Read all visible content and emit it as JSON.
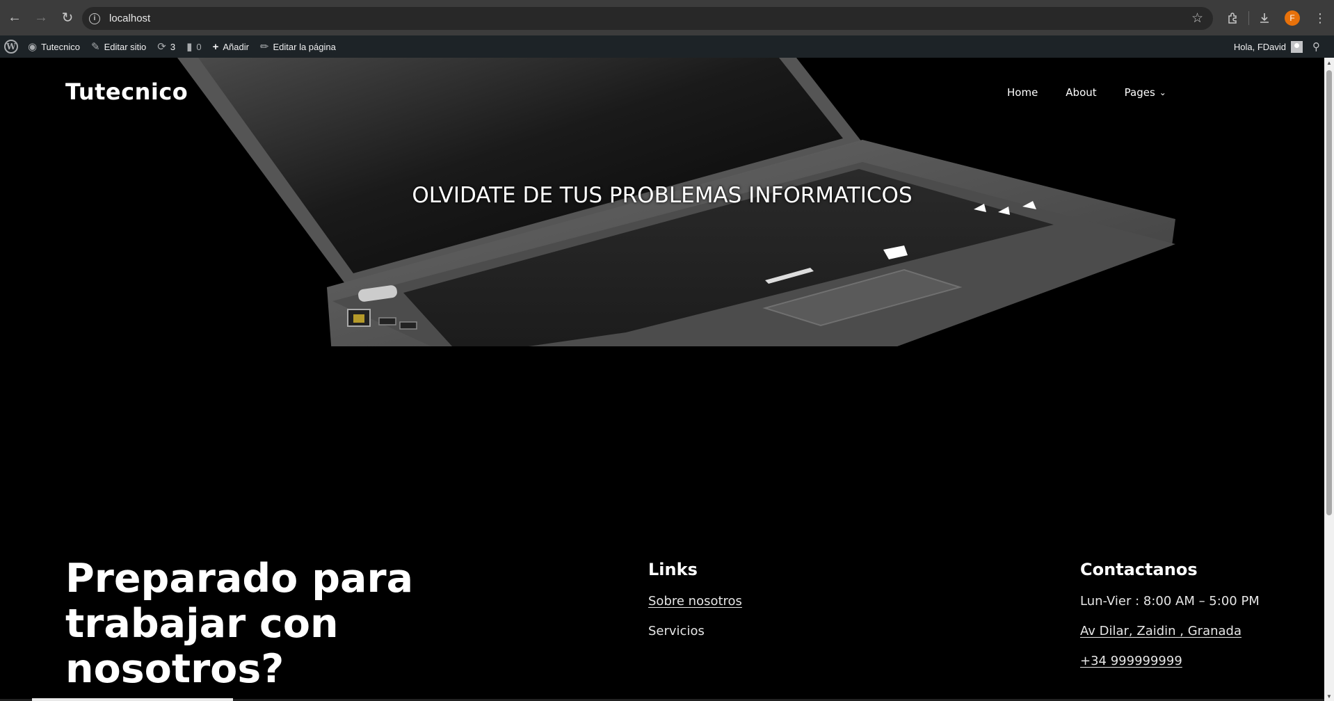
{
  "browser": {
    "url": "localhost",
    "profile_initial": "F",
    "icons": {
      "back": "arrow-left-icon",
      "forward": "arrow-right-icon",
      "reload": "reload-icon",
      "info": "info-icon",
      "bookmark": "star-icon",
      "extensions": "puzzle-icon",
      "downloads": "download-icon",
      "menu": "kebab-menu-icon"
    }
  },
  "admin_bar": {
    "site_name": "Tutecnico",
    "edit_site": "Editar sitio",
    "updates_count": "3",
    "comments_count": "0",
    "add_new": "Añadir",
    "edit_page": "Editar la página",
    "greeting": "Hola, FDavid"
  },
  "header": {
    "site_title": "Tutecnico",
    "nav": [
      {
        "label": "Home"
      },
      {
        "label": "About"
      },
      {
        "label": "Pages"
      }
    ]
  },
  "hero": {
    "heading": "OLVIDATE DE TUS PROBLEMAS INFORMATICOS"
  },
  "footer": {
    "cta": "Preparado para trabajar con nosotros?",
    "links": {
      "heading": "Links",
      "items": [
        "Sobre nosotros",
        "Servicios"
      ]
    },
    "contact": {
      "heading": "Contactanos",
      "hours": "Lun-Vier : 8:00 AM – 5:00 PM",
      "address": "Av Dilar, Zaidin , Granada",
      "phone": "+34 999999999"
    }
  },
  "colors": {
    "page_background": "#000000",
    "admin_bar": "#1d2327",
    "browser_chrome": "#3c3c3c",
    "profile_avatar": "#e8710a"
  }
}
